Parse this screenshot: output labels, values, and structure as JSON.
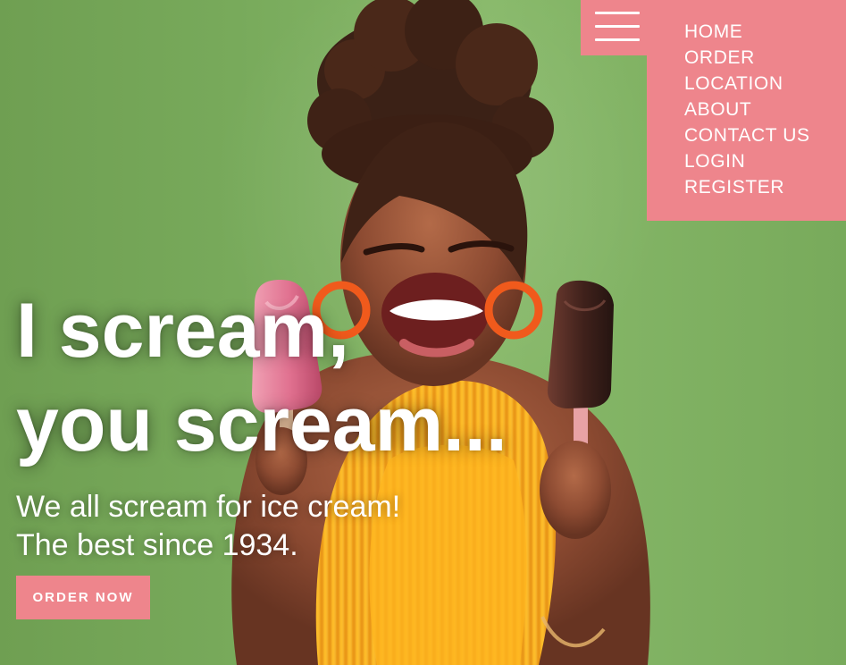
{
  "navigation": {
    "menu_icon": "hamburger-menu-icon",
    "items": [
      {
        "label": "HOME"
      },
      {
        "label": "ORDER"
      },
      {
        "label": "LOCATION"
      },
      {
        "label": "ABOUT"
      },
      {
        "label": "CONTACT US"
      },
      {
        "label": "LOGIN"
      },
      {
        "label": "REGISTER"
      }
    ]
  },
  "hero": {
    "headline_line_1": "I scream,",
    "headline_line_2": "you scream...",
    "tagline_line_1": "We all scream for ice cream!",
    "tagline_line_2": "The best since 1934.",
    "button_label": "ORDER NOW",
    "image_subject": "smiling-person-holding-ice-cream-bars"
  },
  "colors": {
    "background_green": "#79a95c",
    "accent_pink": "#ee858c",
    "text_white": "#ffffff",
    "top_yellow": "#f6b51f",
    "pink_ice_cream": "#e7849c",
    "chocolate_ice_cream": "#4a2720",
    "earring_orange": "#f05a1c"
  }
}
